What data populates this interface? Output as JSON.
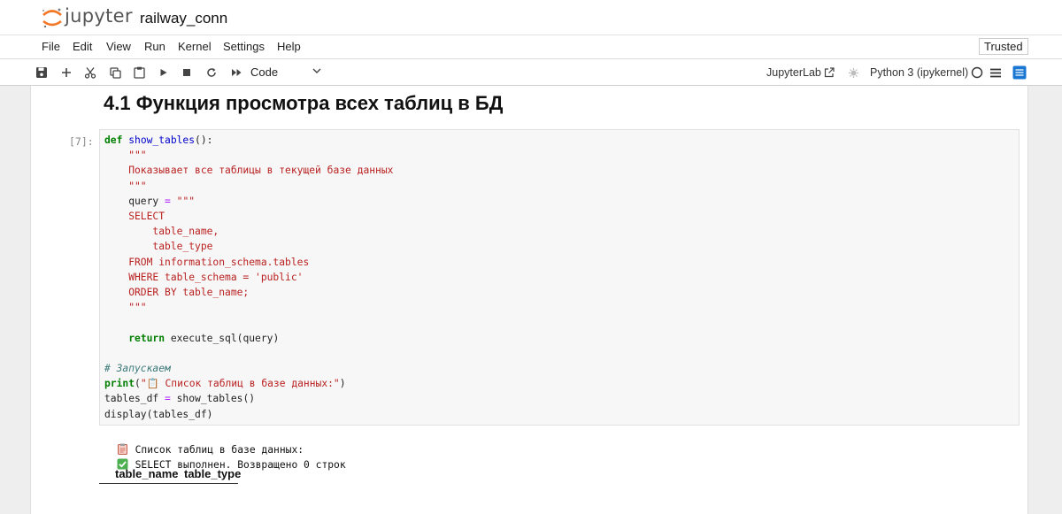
{
  "header": {
    "logo_text": "jupyter",
    "notebook_name": "railway_conn"
  },
  "menu": {
    "items": [
      "File",
      "Edit",
      "View",
      "Run",
      "Kernel",
      "Settings",
      "Help"
    ],
    "trusted": "Trusted"
  },
  "toolbar": {
    "cell_type": "Code",
    "jupyterlab": "JupyterLab",
    "kernel": "Python 3 (ipykernel)"
  },
  "cells": {
    "markdown_heading": "4.1 Функция просмотра всех таблиц в БД",
    "code_prompt": "[7]:",
    "code_lines": [
      "def show_tables():",
      "    \"\"\"",
      "    Показывает все таблицы в текущей базе данных",
      "    \"\"\"",
      "    query = \"\"\"",
      "    SELECT",
      "        table_name,",
      "        table_type",
      "    FROM information_schema.tables",
      "    WHERE table_schema = 'public'",
      "    ORDER BY table_name;",
      "    \"\"\"",
      "",
      "    return execute_sql(query)",
      "",
      "# Запускаем",
      "print(\"📋 Список таблиц в базе данных:\")",
      "tables_df = show_tables()",
      "display(tables_df)"
    ],
    "output_lines": [
      "Список таблиц в базе данных:",
      "SELECT выполнен. Возвращено 0 строк"
    ],
    "table_headers": [
      "table_name",
      "table_type"
    ]
  },
  "colors": {
    "accent": "#f37726",
    "keyword": "#007f00",
    "string": "#ba2121",
    "check": "#4caf50"
  }
}
